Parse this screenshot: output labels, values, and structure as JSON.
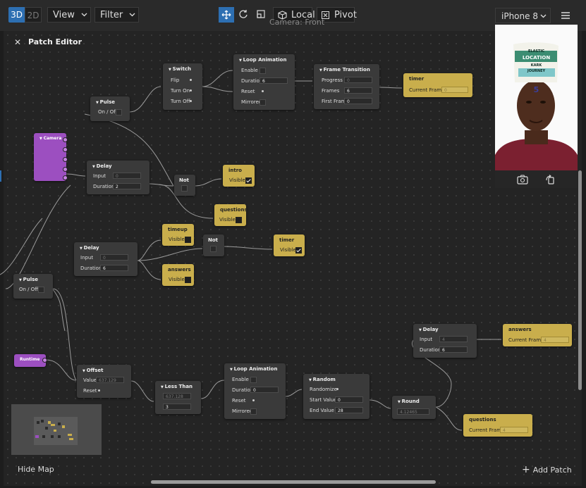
{
  "toolbar": {
    "mode_3d": "3D",
    "mode_2d": "2D",
    "view_label": "View",
    "filter_label": "Filter",
    "local_label": "Local",
    "pivot_label": "Pivot",
    "device_label": "iPhone 8",
    "camera_label": "Camera: Front"
  },
  "patch_editor": {
    "title": "Patch Editor",
    "hide_map_label": "Hide Map",
    "add_patch_label": "Add Patch"
  },
  "preview": {
    "hat_lines": [
      "ELASTIC",
      "LOCATION",
      "KARK",
      "JOURNEY"
    ],
    "hat_number": "5"
  },
  "nodes": {
    "pulse1": {
      "title": "Pulse",
      "on_off": "On / Off"
    },
    "switch": {
      "title": "Switch",
      "flip": "Flip",
      "turn_on": "Turn On",
      "turn_off": "Turn Off"
    },
    "loop1": {
      "title": "Loop Animation",
      "enable": "Enable",
      "duration": "Duration",
      "duration_val": "6",
      "reset": "Reset",
      "mirrored": "Mirrored"
    },
    "frame_transition": {
      "title": "Frame Transition",
      "progress": "Progress",
      "progress_val": "0",
      "frames": "Frames",
      "frames_val": "6",
      "first_frame": "First Frame",
      "first_frame_val": "0"
    },
    "timer1": {
      "title": "timer",
      "label": "Current Frame",
      "value": "0"
    },
    "camera": {
      "title": "Camera"
    },
    "delay1": {
      "title": "Delay",
      "input": "Input",
      "input_val": "0",
      "duration": "Duration",
      "duration_val": "2"
    },
    "not1": {
      "title": "Not"
    },
    "intro": {
      "title": "intro",
      "label": "Visible"
    },
    "questions_vis": {
      "title": "questions",
      "label": "Visible"
    },
    "timeup": {
      "title": "timeup",
      "label": "Visible"
    },
    "delay2": {
      "title": "Delay",
      "input": "Input",
      "input_val": "0",
      "duration": "Duration",
      "duration_val": "6"
    },
    "not2": {
      "title": "Not"
    },
    "timer2": {
      "title": "timer",
      "label": "Visible"
    },
    "answers_vis": {
      "title": "answers",
      "label": "Visible"
    },
    "pulse2": {
      "title": "Pulse",
      "on_off": "On / Off"
    },
    "delay3": {
      "title": "Delay",
      "input": "Input",
      "input_val": "4",
      "duration": "Duration",
      "duration_val": "6"
    },
    "answers_frame": {
      "title": "answers",
      "label": "Current Frame",
      "value": "4"
    },
    "runtime": {
      "title": "Runtime"
    },
    "offset": {
      "title": "Offset",
      "value": "Value",
      "value_val": "637.129",
      "reset": "Reset"
    },
    "less_than": {
      "title": "Less Than",
      "a_val": "637.128",
      "b_val": "3"
    },
    "loop2": {
      "title": "Loop Animation",
      "enable": "Enable",
      "duration": "Duration",
      "duration_val": "0",
      "reset": "Reset",
      "mirrored": "Mirrored"
    },
    "random": {
      "title": "Random",
      "randomize": "Randomize",
      "start": "Start Value",
      "start_val": "0",
      "end": "End Value",
      "end_val": "28"
    },
    "round": {
      "title": "Round",
      "value": "4.12465"
    },
    "questions_frame": {
      "title": "questions",
      "label": "Current Frame",
      "value": "4"
    }
  }
}
